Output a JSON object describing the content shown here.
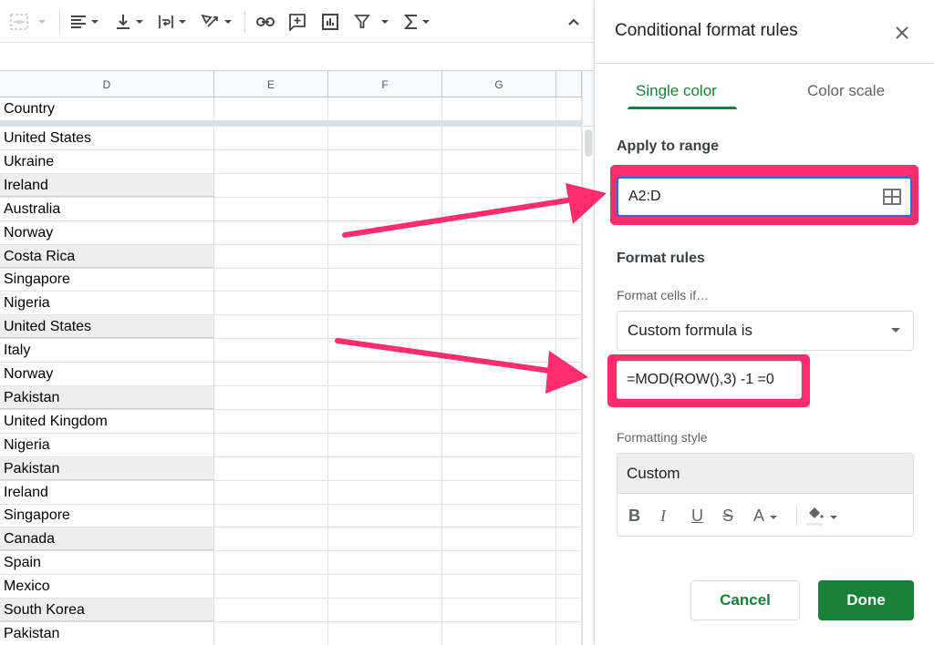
{
  "toolbar": {
    "icons": [
      {
        "name": "merge-cells-icon",
        "disabled": true
      },
      {
        "name": "horizontal-align-icon"
      },
      {
        "name": "vertical-align-icon"
      },
      {
        "name": "text-wrapping-icon"
      },
      {
        "name": "text-rotation-icon"
      },
      {
        "name": "insert-link-icon"
      },
      {
        "name": "insert-comment-icon"
      },
      {
        "name": "insert-chart-icon"
      },
      {
        "name": "filter-icon"
      },
      {
        "name": "functions-icon"
      },
      {
        "name": "collapse-toolbar-icon"
      }
    ]
  },
  "grid": {
    "columns": [
      "D",
      "E",
      "F",
      "G",
      ""
    ],
    "header_row": "Country",
    "rows": [
      {
        "value": "United States",
        "highlighted": false
      },
      {
        "value": "Ukraine",
        "highlighted": false
      },
      {
        "value": "Ireland",
        "highlighted": true
      },
      {
        "value": "Australia",
        "highlighted": false
      },
      {
        "value": "Norway",
        "highlighted": false
      },
      {
        "value": "Costa Rica",
        "highlighted": true
      },
      {
        "value": "Singapore",
        "highlighted": false
      },
      {
        "value": "Nigeria",
        "highlighted": false
      },
      {
        "value": "United States",
        "highlighted": true
      },
      {
        "value": "Italy",
        "highlighted": false
      },
      {
        "value": "Norway",
        "highlighted": false
      },
      {
        "value": "Pakistan",
        "highlighted": true
      },
      {
        "value": "United Kingdom",
        "highlighted": false
      },
      {
        "value": "Nigeria",
        "highlighted": false
      },
      {
        "value": "Pakistan",
        "highlighted": true
      },
      {
        "value": "Ireland",
        "highlighted": false
      },
      {
        "value": "Singapore",
        "highlighted": false
      },
      {
        "value": "Canada",
        "highlighted": true
      },
      {
        "value": "Spain",
        "highlighted": false
      },
      {
        "value": "Mexico",
        "highlighted": false
      },
      {
        "value": "South Korea",
        "highlighted": true
      },
      {
        "value": "Pakistan",
        "highlighted": false
      }
    ],
    "highlight_color": "#eeeeee"
  },
  "panel": {
    "title": "Conditional format rules",
    "tabs": [
      {
        "label": "Single color",
        "active": true
      },
      {
        "label": "Color scale",
        "active": false
      }
    ],
    "apply_to_range_label": "Apply to range",
    "range_value": "A2:D",
    "format_rules_label": "Format rules",
    "format_cells_if_label": "Format cells if…",
    "condition_selected": "Custom formula is",
    "formula_value": "=MOD(ROW(),3) -1 =0",
    "formatting_style_label": "Formatting style",
    "style_preset": "Custom",
    "style_tools": {
      "bold": "B",
      "italic": "I",
      "underline": "U",
      "strikethrough": "S",
      "text_color": "A"
    },
    "cancel_label": "Cancel",
    "done_label": "Done"
  },
  "colors": {
    "accent_green": "#188038",
    "focus_blue": "#1a73e8",
    "annotation_pink": "#ff2d6b"
  }
}
